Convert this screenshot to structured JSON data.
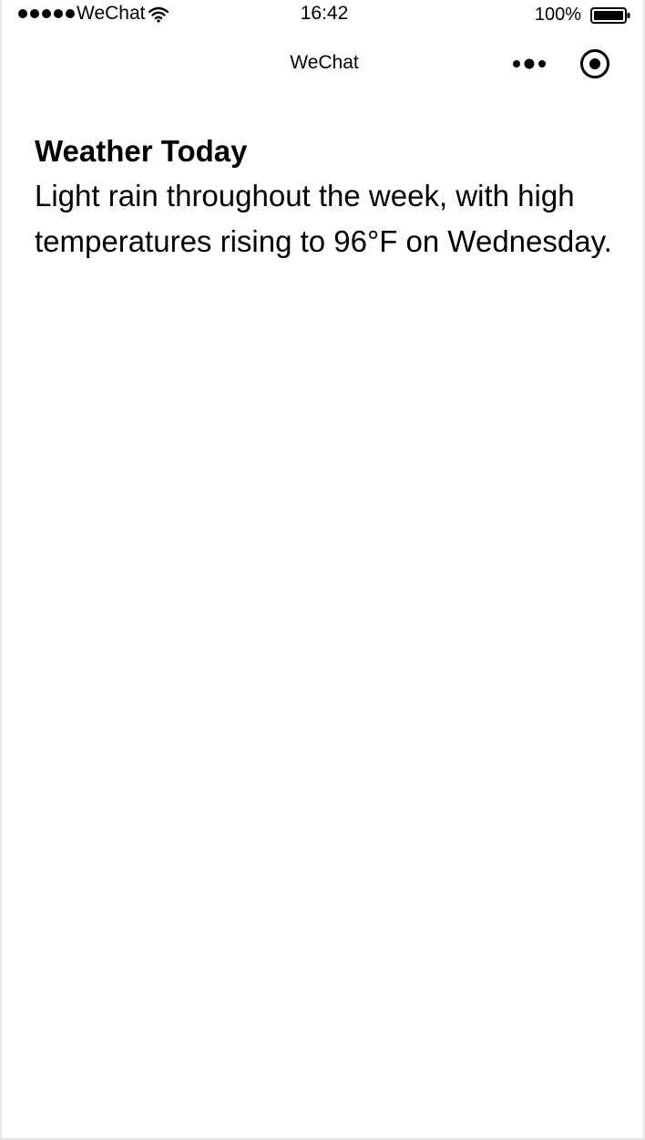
{
  "status_bar": {
    "carrier": "WeChat",
    "time": "16:42",
    "battery": "100%",
    "signal_icon": "signal-dots-icon",
    "wifi_icon": "wifi-icon",
    "battery_icon": "battery-icon"
  },
  "nav": {
    "title": "WeChat",
    "more_icon": "more-dots-icon",
    "close_icon": "target-circle-icon"
  },
  "content": {
    "title": "Weather Today",
    "description": "Light rain throughout the week, with high temperatures rising to 96°F on Wednesday."
  }
}
